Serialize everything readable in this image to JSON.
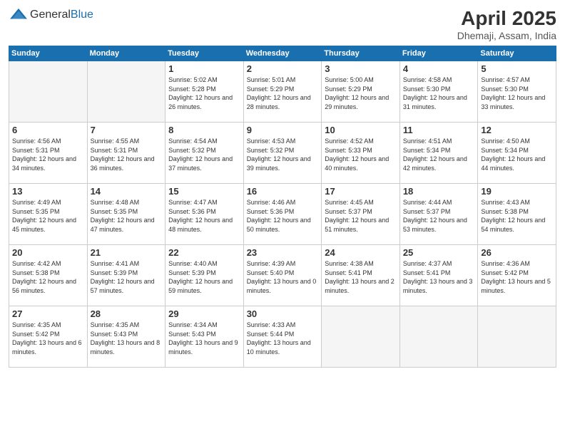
{
  "header": {
    "logo_general": "General",
    "logo_blue": "Blue",
    "month_title": "April 2025",
    "location": "Dhemaji, Assam, India"
  },
  "weekdays": [
    "Sunday",
    "Monday",
    "Tuesday",
    "Wednesday",
    "Thursday",
    "Friday",
    "Saturday"
  ],
  "weeks": [
    [
      {
        "day": "",
        "sunrise": "",
        "sunset": "",
        "daylight": "",
        "empty": true
      },
      {
        "day": "",
        "sunrise": "",
        "sunset": "",
        "daylight": "",
        "empty": true
      },
      {
        "day": "1",
        "sunrise": "Sunrise: 5:02 AM",
        "sunset": "Sunset: 5:28 PM",
        "daylight": "Daylight: 12 hours and 26 minutes."
      },
      {
        "day": "2",
        "sunrise": "Sunrise: 5:01 AM",
        "sunset": "Sunset: 5:29 PM",
        "daylight": "Daylight: 12 hours and 28 minutes."
      },
      {
        "day": "3",
        "sunrise": "Sunrise: 5:00 AM",
        "sunset": "Sunset: 5:29 PM",
        "daylight": "Daylight: 12 hours and 29 minutes."
      },
      {
        "day": "4",
        "sunrise": "Sunrise: 4:58 AM",
        "sunset": "Sunset: 5:30 PM",
        "daylight": "Daylight: 12 hours and 31 minutes."
      },
      {
        "day": "5",
        "sunrise": "Sunrise: 4:57 AM",
        "sunset": "Sunset: 5:30 PM",
        "daylight": "Daylight: 12 hours and 33 minutes."
      }
    ],
    [
      {
        "day": "6",
        "sunrise": "Sunrise: 4:56 AM",
        "sunset": "Sunset: 5:31 PM",
        "daylight": "Daylight: 12 hours and 34 minutes."
      },
      {
        "day": "7",
        "sunrise": "Sunrise: 4:55 AM",
        "sunset": "Sunset: 5:31 PM",
        "daylight": "Daylight: 12 hours and 36 minutes."
      },
      {
        "day": "8",
        "sunrise": "Sunrise: 4:54 AM",
        "sunset": "Sunset: 5:32 PM",
        "daylight": "Daylight: 12 hours and 37 minutes."
      },
      {
        "day": "9",
        "sunrise": "Sunrise: 4:53 AM",
        "sunset": "Sunset: 5:32 PM",
        "daylight": "Daylight: 12 hours and 39 minutes."
      },
      {
        "day": "10",
        "sunrise": "Sunrise: 4:52 AM",
        "sunset": "Sunset: 5:33 PM",
        "daylight": "Daylight: 12 hours and 40 minutes."
      },
      {
        "day": "11",
        "sunrise": "Sunrise: 4:51 AM",
        "sunset": "Sunset: 5:34 PM",
        "daylight": "Daylight: 12 hours and 42 minutes."
      },
      {
        "day": "12",
        "sunrise": "Sunrise: 4:50 AM",
        "sunset": "Sunset: 5:34 PM",
        "daylight": "Daylight: 12 hours and 44 minutes."
      }
    ],
    [
      {
        "day": "13",
        "sunrise": "Sunrise: 4:49 AM",
        "sunset": "Sunset: 5:35 PM",
        "daylight": "Daylight: 12 hours and 45 minutes."
      },
      {
        "day": "14",
        "sunrise": "Sunrise: 4:48 AM",
        "sunset": "Sunset: 5:35 PM",
        "daylight": "Daylight: 12 hours and 47 minutes."
      },
      {
        "day": "15",
        "sunrise": "Sunrise: 4:47 AM",
        "sunset": "Sunset: 5:36 PM",
        "daylight": "Daylight: 12 hours and 48 minutes."
      },
      {
        "day": "16",
        "sunrise": "Sunrise: 4:46 AM",
        "sunset": "Sunset: 5:36 PM",
        "daylight": "Daylight: 12 hours and 50 minutes."
      },
      {
        "day": "17",
        "sunrise": "Sunrise: 4:45 AM",
        "sunset": "Sunset: 5:37 PM",
        "daylight": "Daylight: 12 hours and 51 minutes."
      },
      {
        "day": "18",
        "sunrise": "Sunrise: 4:44 AM",
        "sunset": "Sunset: 5:37 PM",
        "daylight": "Daylight: 12 hours and 53 minutes."
      },
      {
        "day": "19",
        "sunrise": "Sunrise: 4:43 AM",
        "sunset": "Sunset: 5:38 PM",
        "daylight": "Daylight: 12 hours and 54 minutes."
      }
    ],
    [
      {
        "day": "20",
        "sunrise": "Sunrise: 4:42 AM",
        "sunset": "Sunset: 5:38 PM",
        "daylight": "Daylight: 12 hours and 56 minutes."
      },
      {
        "day": "21",
        "sunrise": "Sunrise: 4:41 AM",
        "sunset": "Sunset: 5:39 PM",
        "daylight": "Daylight: 12 hours and 57 minutes."
      },
      {
        "day": "22",
        "sunrise": "Sunrise: 4:40 AM",
        "sunset": "Sunset: 5:39 PM",
        "daylight": "Daylight: 12 hours and 59 minutes."
      },
      {
        "day": "23",
        "sunrise": "Sunrise: 4:39 AM",
        "sunset": "Sunset: 5:40 PM",
        "daylight": "Daylight: 13 hours and 0 minutes."
      },
      {
        "day": "24",
        "sunrise": "Sunrise: 4:38 AM",
        "sunset": "Sunset: 5:41 PM",
        "daylight": "Daylight: 13 hours and 2 minutes."
      },
      {
        "day": "25",
        "sunrise": "Sunrise: 4:37 AM",
        "sunset": "Sunset: 5:41 PM",
        "daylight": "Daylight: 13 hours and 3 minutes."
      },
      {
        "day": "26",
        "sunrise": "Sunrise: 4:36 AM",
        "sunset": "Sunset: 5:42 PM",
        "daylight": "Daylight: 13 hours and 5 minutes."
      }
    ],
    [
      {
        "day": "27",
        "sunrise": "Sunrise: 4:35 AM",
        "sunset": "Sunset: 5:42 PM",
        "daylight": "Daylight: 13 hours and 6 minutes."
      },
      {
        "day": "28",
        "sunrise": "Sunrise: 4:35 AM",
        "sunset": "Sunset: 5:43 PM",
        "daylight": "Daylight: 13 hours and 8 minutes."
      },
      {
        "day": "29",
        "sunrise": "Sunrise: 4:34 AM",
        "sunset": "Sunset: 5:43 PM",
        "daylight": "Daylight: 13 hours and 9 minutes."
      },
      {
        "day": "30",
        "sunrise": "Sunrise: 4:33 AM",
        "sunset": "Sunset: 5:44 PM",
        "daylight": "Daylight: 13 hours and 10 minutes."
      },
      {
        "day": "",
        "sunrise": "",
        "sunset": "",
        "daylight": "",
        "empty": true
      },
      {
        "day": "",
        "sunrise": "",
        "sunset": "",
        "daylight": "",
        "empty": true
      },
      {
        "day": "",
        "sunrise": "",
        "sunset": "",
        "daylight": "",
        "empty": true
      }
    ]
  ]
}
